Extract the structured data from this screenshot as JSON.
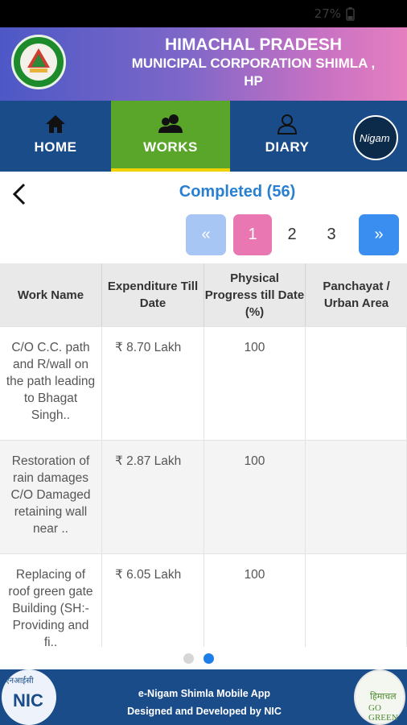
{
  "status_bar": {
    "battery_text": "27%"
  },
  "header": {
    "title_line1": "HIMACHAL PRADESH",
    "title_line2": "MUNICIPAL CORPORATION SHIMLA ,",
    "title_line3": "HP"
  },
  "nav": {
    "items": [
      {
        "label": "HOME",
        "icon": "home-icon"
      },
      {
        "label": "WORKS",
        "icon": "group-icon",
        "active": true
      },
      {
        "label": "DIARY",
        "icon": "person-icon"
      }
    ],
    "enigam_logo_text": "Nigam"
  },
  "page": {
    "heading": "Completed (56)"
  },
  "pagination": {
    "prev": "«",
    "pages": [
      "1",
      "2",
      "3"
    ],
    "current": "1",
    "next": "»"
  },
  "table": {
    "columns": [
      "Work Name",
      "Expenditure Till Date",
      "Physical Progress till Date (%)",
      "Panchayat / Urban Area"
    ],
    "rows": [
      {
        "name": "C/O C.C. path and R/wall on the path leading to Bhagat Singh..",
        "expenditure": "₹ 8.70 Lakh",
        "progress": "100",
        "area": ""
      },
      {
        "name": "Restoration of rain damages C/O Damaged retaining wall near ..",
        "expenditure": "₹ 2.87 Lakh",
        "progress": "100",
        "area": ""
      },
      {
        "name": "Replacing of roof green gate Building (SH:- Providing and fi..",
        "expenditure": "₹ 6.05 Lakh",
        "progress": "100",
        "area": ""
      }
    ]
  },
  "page_indicator": {
    "count": 2,
    "active": 2
  },
  "footer": {
    "line1": "e-Nigam Shimla Mobile App",
    "line2": "Designed and Developed by NIC",
    "nic_logo_text_top": "एनआईसी",
    "nic_logo_text": "NIC",
    "go_green_top": "हिमाचल",
    "go_green_bottom": "GO GREEN"
  },
  "colors": {
    "nav_bg": "#1a4c8a",
    "works_active": "#5aa62b",
    "heading_blue": "#2980d1",
    "page_active": "#e877b2",
    "next_button": "#3a8ef0"
  }
}
